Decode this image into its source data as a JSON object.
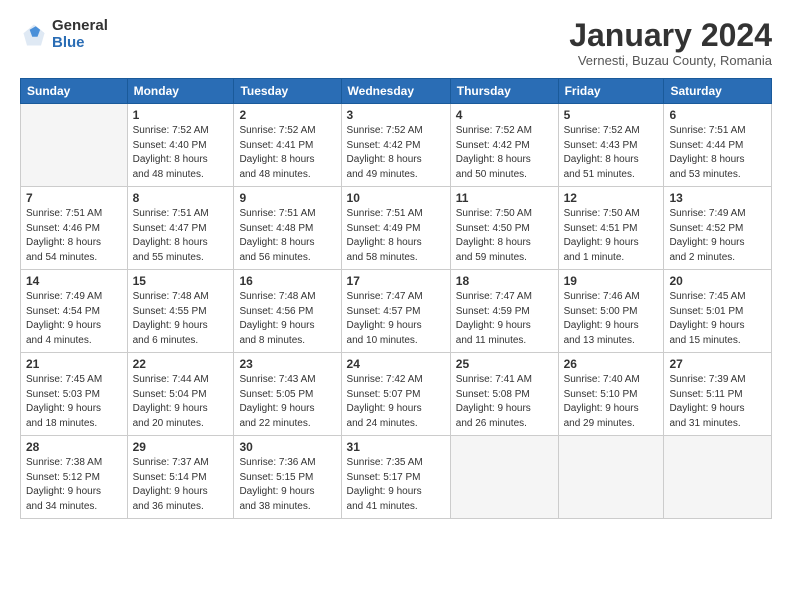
{
  "logo": {
    "general": "General",
    "blue": "Blue"
  },
  "header": {
    "month": "January 2024",
    "location": "Vernesti, Buzau County, Romania"
  },
  "weekdays": [
    "Sunday",
    "Monday",
    "Tuesday",
    "Wednesday",
    "Thursday",
    "Friday",
    "Saturday"
  ],
  "weeks": [
    [
      {
        "day": "",
        "info": ""
      },
      {
        "day": "1",
        "info": "Sunrise: 7:52 AM\nSunset: 4:40 PM\nDaylight: 8 hours\nand 48 minutes."
      },
      {
        "day": "2",
        "info": "Sunrise: 7:52 AM\nSunset: 4:41 PM\nDaylight: 8 hours\nand 48 minutes."
      },
      {
        "day": "3",
        "info": "Sunrise: 7:52 AM\nSunset: 4:42 PM\nDaylight: 8 hours\nand 49 minutes."
      },
      {
        "day": "4",
        "info": "Sunrise: 7:52 AM\nSunset: 4:42 PM\nDaylight: 8 hours\nand 50 minutes."
      },
      {
        "day": "5",
        "info": "Sunrise: 7:52 AM\nSunset: 4:43 PM\nDaylight: 8 hours\nand 51 minutes."
      },
      {
        "day": "6",
        "info": "Sunrise: 7:51 AM\nSunset: 4:44 PM\nDaylight: 8 hours\nand 53 minutes."
      }
    ],
    [
      {
        "day": "7",
        "info": "Sunrise: 7:51 AM\nSunset: 4:46 PM\nDaylight: 8 hours\nand 54 minutes."
      },
      {
        "day": "8",
        "info": "Sunrise: 7:51 AM\nSunset: 4:47 PM\nDaylight: 8 hours\nand 55 minutes."
      },
      {
        "day": "9",
        "info": "Sunrise: 7:51 AM\nSunset: 4:48 PM\nDaylight: 8 hours\nand 56 minutes."
      },
      {
        "day": "10",
        "info": "Sunrise: 7:51 AM\nSunset: 4:49 PM\nDaylight: 8 hours\nand 58 minutes."
      },
      {
        "day": "11",
        "info": "Sunrise: 7:50 AM\nSunset: 4:50 PM\nDaylight: 8 hours\nand 59 minutes."
      },
      {
        "day": "12",
        "info": "Sunrise: 7:50 AM\nSunset: 4:51 PM\nDaylight: 9 hours\nand 1 minute."
      },
      {
        "day": "13",
        "info": "Sunrise: 7:49 AM\nSunset: 4:52 PM\nDaylight: 9 hours\nand 2 minutes."
      }
    ],
    [
      {
        "day": "14",
        "info": "Sunrise: 7:49 AM\nSunset: 4:54 PM\nDaylight: 9 hours\nand 4 minutes."
      },
      {
        "day": "15",
        "info": "Sunrise: 7:48 AM\nSunset: 4:55 PM\nDaylight: 9 hours\nand 6 minutes."
      },
      {
        "day": "16",
        "info": "Sunrise: 7:48 AM\nSunset: 4:56 PM\nDaylight: 9 hours\nand 8 minutes."
      },
      {
        "day": "17",
        "info": "Sunrise: 7:47 AM\nSunset: 4:57 PM\nDaylight: 9 hours\nand 10 minutes."
      },
      {
        "day": "18",
        "info": "Sunrise: 7:47 AM\nSunset: 4:59 PM\nDaylight: 9 hours\nand 11 minutes."
      },
      {
        "day": "19",
        "info": "Sunrise: 7:46 AM\nSunset: 5:00 PM\nDaylight: 9 hours\nand 13 minutes."
      },
      {
        "day": "20",
        "info": "Sunrise: 7:45 AM\nSunset: 5:01 PM\nDaylight: 9 hours\nand 15 minutes."
      }
    ],
    [
      {
        "day": "21",
        "info": "Sunrise: 7:45 AM\nSunset: 5:03 PM\nDaylight: 9 hours\nand 18 minutes."
      },
      {
        "day": "22",
        "info": "Sunrise: 7:44 AM\nSunset: 5:04 PM\nDaylight: 9 hours\nand 20 minutes."
      },
      {
        "day": "23",
        "info": "Sunrise: 7:43 AM\nSunset: 5:05 PM\nDaylight: 9 hours\nand 22 minutes."
      },
      {
        "day": "24",
        "info": "Sunrise: 7:42 AM\nSunset: 5:07 PM\nDaylight: 9 hours\nand 24 minutes."
      },
      {
        "day": "25",
        "info": "Sunrise: 7:41 AM\nSunset: 5:08 PM\nDaylight: 9 hours\nand 26 minutes."
      },
      {
        "day": "26",
        "info": "Sunrise: 7:40 AM\nSunset: 5:10 PM\nDaylight: 9 hours\nand 29 minutes."
      },
      {
        "day": "27",
        "info": "Sunrise: 7:39 AM\nSunset: 5:11 PM\nDaylight: 9 hours\nand 31 minutes."
      }
    ],
    [
      {
        "day": "28",
        "info": "Sunrise: 7:38 AM\nSunset: 5:12 PM\nDaylight: 9 hours\nand 34 minutes."
      },
      {
        "day": "29",
        "info": "Sunrise: 7:37 AM\nSunset: 5:14 PM\nDaylight: 9 hours\nand 36 minutes."
      },
      {
        "day": "30",
        "info": "Sunrise: 7:36 AM\nSunset: 5:15 PM\nDaylight: 9 hours\nand 38 minutes."
      },
      {
        "day": "31",
        "info": "Sunrise: 7:35 AM\nSunset: 5:17 PM\nDaylight: 9 hours\nand 41 minutes."
      },
      {
        "day": "",
        "info": ""
      },
      {
        "day": "",
        "info": ""
      },
      {
        "day": "",
        "info": ""
      }
    ]
  ]
}
